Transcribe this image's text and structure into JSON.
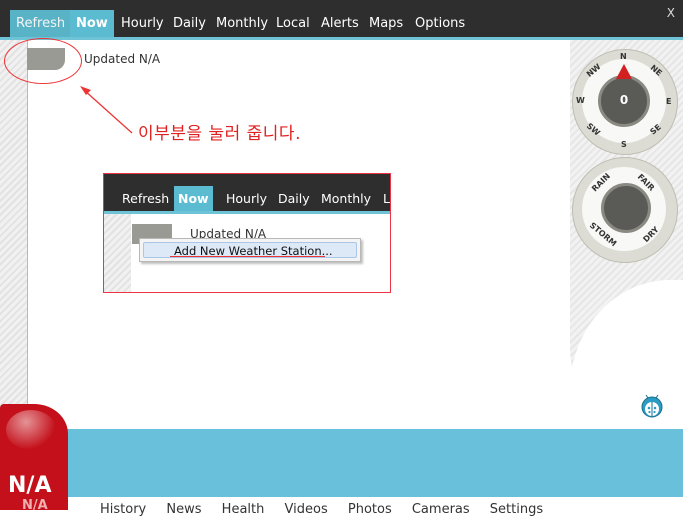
{
  "topbar": {
    "tabs": [
      "Refresh",
      "Now",
      "Hourly",
      "Daily",
      "Monthly",
      "Local",
      "Alerts",
      "Maps",
      "Options"
    ],
    "active_tab": "Now",
    "close_label": "X"
  },
  "main": {
    "updated_text": "Updated N/A",
    "annotation_note": "이부분을 눌러 줍니다."
  },
  "compass": {
    "value": "0",
    "labels": [
      "N",
      "NE",
      "E",
      "SE",
      "S",
      "SW",
      "W",
      "NW"
    ]
  },
  "weather_dial": {
    "labels": [
      "RAIN",
      "FAIR",
      "STORM",
      "DRY"
    ]
  },
  "inset": {
    "tabs": [
      "Refresh",
      "Now",
      "Hourly",
      "Daily",
      "Monthly",
      "L"
    ],
    "active_tab": "Now",
    "updated_text": "Updated N/A",
    "menu_item": "Add New Weather Station..."
  },
  "bottom": {
    "badge_main": "N/A",
    "badge_sub": "N/A",
    "nav": [
      "History",
      "News",
      "Health",
      "Videos",
      "Photos",
      "Cameras",
      "Settings"
    ]
  },
  "colors": {
    "topbar_bg": "#2e2e2e",
    "accent": "#5bbbd0",
    "bottom_bar": "#68c0db",
    "badge_red": "#c4101a",
    "annotation_red": "#e02020"
  }
}
